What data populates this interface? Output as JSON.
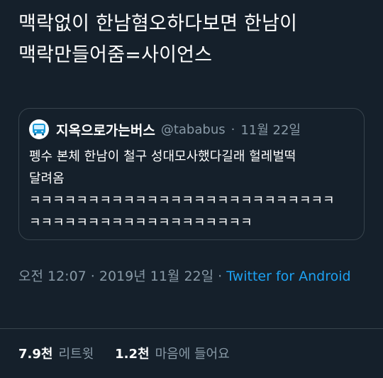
{
  "tweet": {
    "text": "맥락없이 한남혐오하다보면 한남이\n맥락만들어줌=사이언스"
  },
  "quote": {
    "name": "지옥으로가는버스",
    "handle": "@tababus",
    "separator": "·",
    "date": "11월 22일",
    "text": "펭수 본체 한남이 철구 성대모사했다길래 헐레벌떡\n달려옴\nㅋㅋㅋㅋㅋㅋㅋㅋㅋㅋㅋㅋㅋㅋㅋㅋㅋㅋㅋㅋㅋㅋㅋㅋㅋㅋ\nㅋㅋㅋㅋㅋㅋㅋㅋㅋㅋㅋㅋㅋㅋㅋㅋㅋㅋㅋ",
    "avatar_icon": "bus-icon"
  },
  "meta": {
    "timestamp": "오전 12:07 · 2019년 11월 22일 · ",
    "source": "Twitter for Android"
  },
  "stats": {
    "retweets_count": "7.9천",
    "retweets_label": "리트윗",
    "likes_count": "1.2천",
    "likes_label": "마음에 들어요"
  },
  "colors": {
    "background": "#15202b",
    "secondary_text": "#8899a6",
    "link": "#1da1f2",
    "border": "#38444d"
  }
}
